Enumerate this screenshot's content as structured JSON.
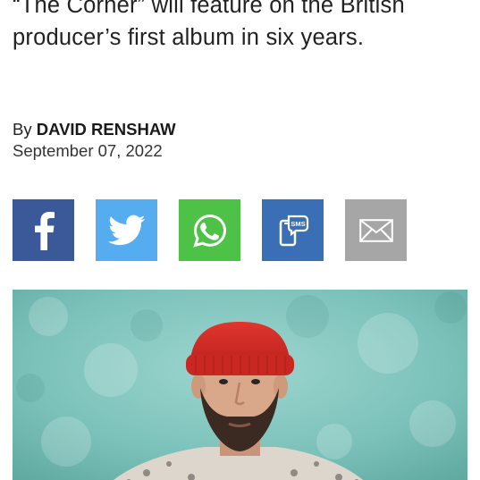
{
  "article": {
    "subheading": "“The Corner” will feature on the British producer’s first album in six years.",
    "byline_prefix": "By",
    "author": "DAVID RENSHAW",
    "date": "September 07, 2022"
  },
  "share": {
    "buttons": [
      {
        "name": "facebook",
        "icon": "facebook-icon",
        "color": "#3b5998"
      },
      {
        "name": "twitter",
        "icon": "twitter-bird-icon",
        "color": "#55acee"
      },
      {
        "name": "whatsapp",
        "icon": "whatsapp-icon",
        "color": "#4dc247"
      },
      {
        "name": "sms",
        "icon": "sms-icon",
        "color": "#3a6fb6"
      },
      {
        "name": "email",
        "icon": "envelope-icon",
        "color": "#a6a6a6"
      }
    ]
  },
  "image": {
    "subject": "man-in-red-beanie-photo",
    "background_color": "#7fc4bd"
  }
}
